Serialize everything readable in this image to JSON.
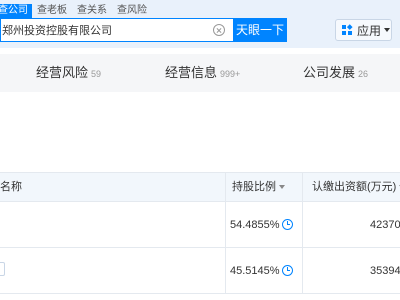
{
  "search": {
    "tabs": [
      {
        "label": "查公司",
        "active": true
      },
      {
        "label": "查老板",
        "active": false
      },
      {
        "label": "查关系",
        "active": false
      },
      {
        "label": "查风险",
        "active": false
      }
    ],
    "query": "郑州投资控股有限公司",
    "button_label": "天眼一下",
    "clear_icon": "close-circle-icon"
  },
  "app_menu": {
    "label": "应用",
    "icon": "apps-grid-icon",
    "caret_icon": "caret-down-icon"
  },
  "section_tabs": [
    {
      "label": "经营风险",
      "count": "59"
    },
    {
      "label": "经营信息",
      "count": "999+"
    },
    {
      "label": "公司发展",
      "count": "26"
    }
  ],
  "shareholder_table": {
    "columns": [
      "名称",
      "持股比例",
      "认缴出资额(万元)"
    ],
    "rows": [
      {
        "ratio": "54.4855%",
        "amount": "42370"
      },
      {
        "ratio": "45.5145%",
        "amount": "35394"
      }
    ]
  },
  "colors": {
    "accent": "#0084ff",
    "header_bg": "#e9f1fb",
    "section_bg": "#f5f6f8",
    "table_header_bg": "#f2f7fc"
  }
}
